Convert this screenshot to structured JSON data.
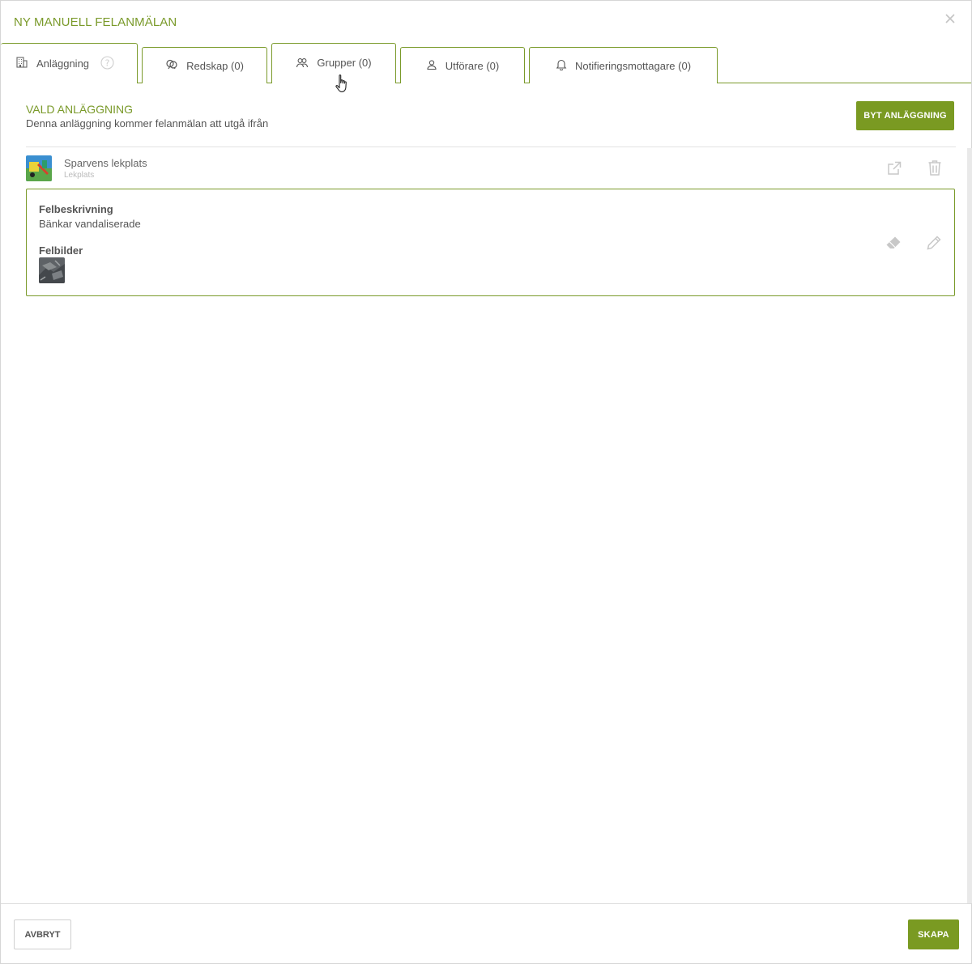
{
  "dialog": {
    "title": "NY MANUELL FELANMÄLAN"
  },
  "tabs": [
    {
      "label": "Anläggning",
      "icon": "building-icon"
    },
    {
      "label": "Redskap (0)",
      "icon": "playground-equipment-icon"
    },
    {
      "label": "Grupper (0)",
      "icon": "group-icon"
    },
    {
      "label": "Utförare (0)",
      "icon": "user-icon"
    },
    {
      "label": "Notifieringsmottagare (0)",
      "icon": "bell-icon"
    }
  ],
  "section": {
    "title": "VALD ANLÄGGNING",
    "subtitle": "Denna anläggning kommer felanmälan att utgå ifrån",
    "change_button": "BYT ANLÄGGNING"
  },
  "facility": {
    "name": "Sparvens lekplats",
    "type": "Lekplats"
  },
  "fault": {
    "description_label": "Felbeskrivning",
    "description_value": "Bänkar vandaliserade",
    "images_label": "Felbilder"
  },
  "footer": {
    "cancel_button": "AVBRYT",
    "create_button": "SKAPA"
  },
  "colors": {
    "accent": "#7a9a22",
    "text": "#555555",
    "muted_icon": "#c8c8c8"
  }
}
